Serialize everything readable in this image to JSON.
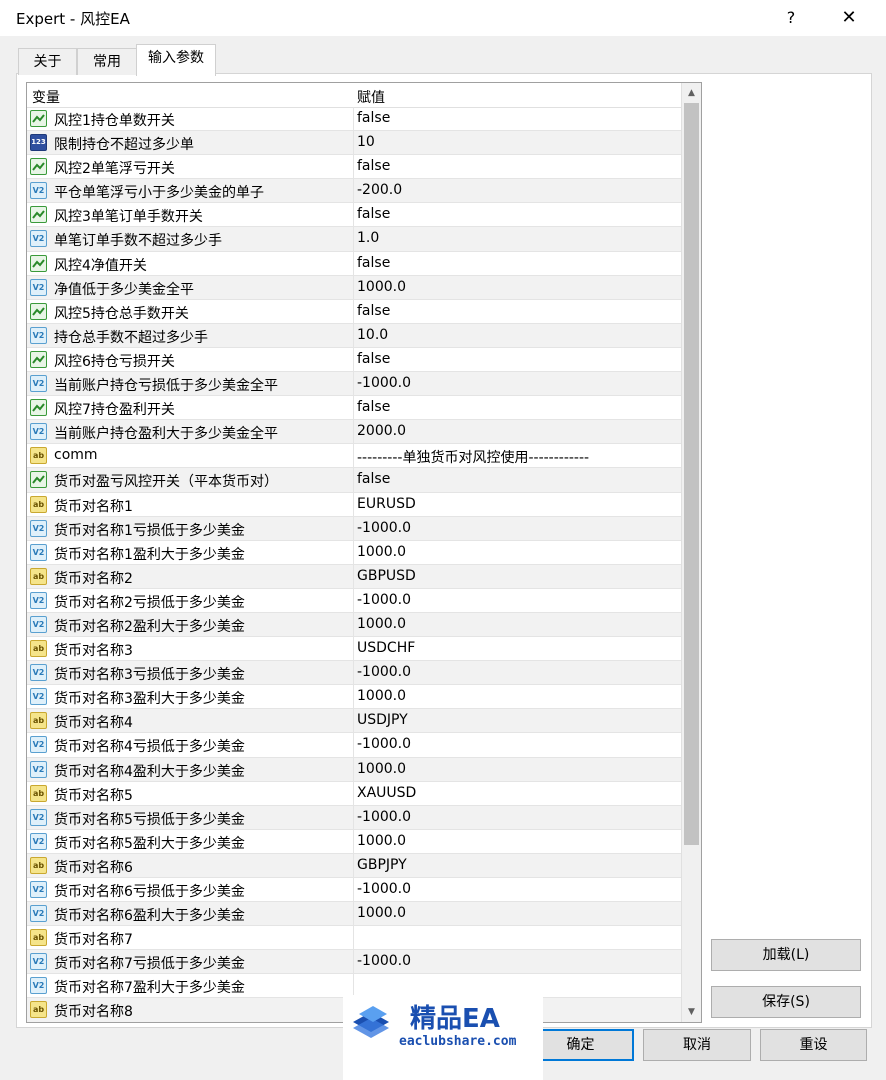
{
  "window": {
    "title": "Expert - 风控EA",
    "help_glyph": "?",
    "close_glyph": "✕"
  },
  "tabs": [
    {
      "label": "关于"
    },
    {
      "label": "常用"
    },
    {
      "label": "输入参数"
    }
  ],
  "grid": {
    "col_variable": "变量",
    "col_value": "赋值",
    "rows": [
      {
        "type": "bool",
        "name": "风控1持仓单数开关",
        "value": "false"
      },
      {
        "type": "int",
        "name": "限制持仓不超过多少单",
        "value": "10"
      },
      {
        "type": "bool",
        "name": "风控2单笔浮亏开关",
        "value": "false"
      },
      {
        "type": "double",
        "name": "平仓单笔浮亏小于多少美金的单子",
        "value": "-200.0"
      },
      {
        "type": "bool",
        "name": "风控3单笔订单手数开关",
        "value": "false"
      },
      {
        "type": "double",
        "name": "单笔订单手数不超过多少手",
        "value": "1.0"
      },
      {
        "type": "bool",
        "name": "风控4净值开关",
        "value": "false"
      },
      {
        "type": "double",
        "name": "净值低于多少美金全平",
        "value": "1000.0"
      },
      {
        "type": "bool",
        "name": "风控5持仓总手数开关",
        "value": "false"
      },
      {
        "type": "double",
        "name": "持仓总手数不超过多少手",
        "value": "10.0"
      },
      {
        "type": "bool",
        "name": "风控6持仓亏损开关",
        "value": "false"
      },
      {
        "type": "double",
        "name": "当前账户持仓亏损低于多少美金全平",
        "value": "-1000.0"
      },
      {
        "type": "bool",
        "name": "风控7持仓盈利开关",
        "value": "false"
      },
      {
        "type": "double",
        "name": "当前账户持仓盈利大于多少美金全平",
        "value": "2000.0"
      },
      {
        "type": "string",
        "name": "comm",
        "value": "---------单独货币对风控使用------------"
      },
      {
        "type": "bool",
        "name": "货币对盈亏风控开关（平本货币对）",
        "value": "false"
      },
      {
        "type": "string",
        "name": "货币对名称1",
        "value": "EURUSD"
      },
      {
        "type": "double",
        "name": "货币对名称1亏损低于多少美金",
        "value": "-1000.0"
      },
      {
        "type": "double",
        "name": "货币对名称1盈利大于多少美金",
        "value": "1000.0"
      },
      {
        "type": "string",
        "name": "货币对名称2",
        "value": "GBPUSD"
      },
      {
        "type": "double",
        "name": "货币对名称2亏损低于多少美金",
        "value": "-1000.0"
      },
      {
        "type": "double",
        "name": "货币对名称2盈利大于多少美金",
        "value": "1000.0"
      },
      {
        "type": "string",
        "name": "货币对名称3",
        "value": "USDCHF"
      },
      {
        "type": "double",
        "name": "货币对名称3亏损低于多少美金",
        "value": "-1000.0"
      },
      {
        "type": "double",
        "name": "货币对名称3盈利大于多少美金",
        "value": "1000.0"
      },
      {
        "type": "string",
        "name": "货币对名称4",
        "value": "USDJPY"
      },
      {
        "type": "double",
        "name": "货币对名称4亏损低于多少美金",
        "value": "-1000.0"
      },
      {
        "type": "double",
        "name": "货币对名称4盈利大于多少美金",
        "value": "1000.0"
      },
      {
        "type": "string",
        "name": "货币对名称5",
        "value": "XAUUSD"
      },
      {
        "type": "double",
        "name": "货币对名称5亏损低于多少美金",
        "value": "-1000.0"
      },
      {
        "type": "double",
        "name": "货币对名称5盈利大于多少美金",
        "value": "1000.0"
      },
      {
        "type": "string",
        "name": "货币对名称6",
        "value": "GBPJPY"
      },
      {
        "type": "double",
        "name": "货币对名称6亏损低于多少美金",
        "value": "-1000.0"
      },
      {
        "type": "double",
        "name": "货币对名称6盈利大于多少美金",
        "value": "1000.0"
      },
      {
        "type": "string",
        "name": "货币对名称7",
        "value": ""
      },
      {
        "type": "double",
        "name": "货币对名称7亏损低于多少美金",
        "value": "-1000.0"
      },
      {
        "type": "double",
        "name": "货币对名称7盈利大于多少美金",
        "value": ""
      },
      {
        "type": "string",
        "name": "货币对名称8",
        "value": ""
      }
    ]
  },
  "icons": {
    "bool": "bool-param-icon",
    "int": "int-param-icon",
    "double": "double-param-icon",
    "string": "string-param-icon"
  },
  "icon_text": {
    "int": "123",
    "double": "V2",
    "string": "ab"
  },
  "buttons": {
    "load": "加载(L)",
    "save": "保存(S)",
    "ok": "确定",
    "cancel": "取消",
    "reset": "重设"
  },
  "watermark": {
    "brand": "精品EA",
    "site": "eaclubshare.com"
  }
}
